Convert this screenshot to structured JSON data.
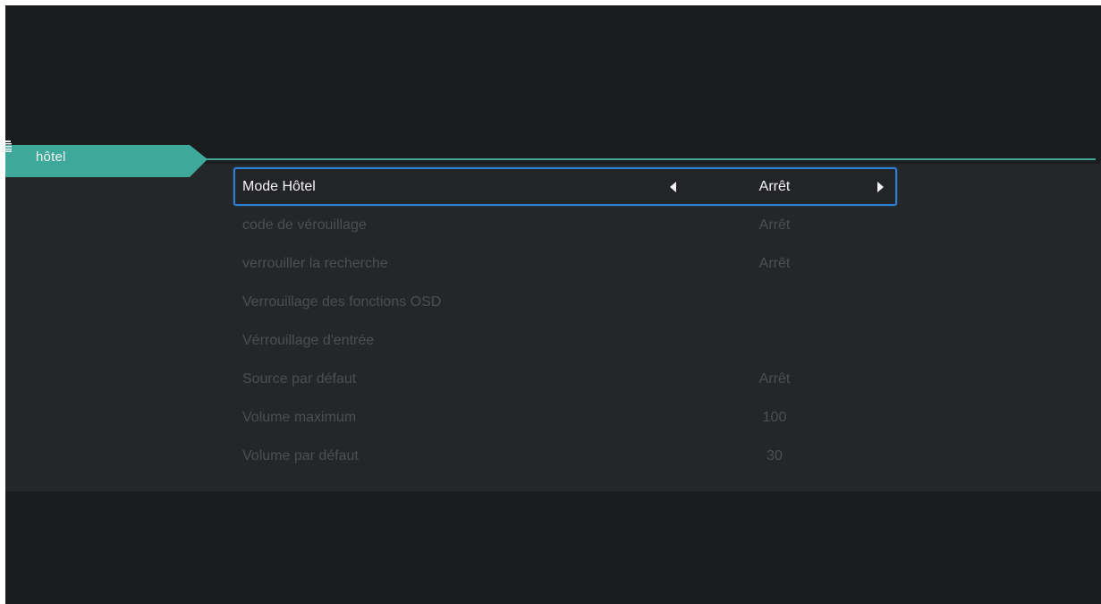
{
  "category": {
    "label": "hôtel",
    "icon": "list-icon",
    "accent_color": "#3ea89a"
  },
  "menu": {
    "items": [
      {
        "label": "Mode Hôtel",
        "value": "Arrêt"
      },
      {
        "label": "code de vérouillage",
        "value": "Arrêt"
      },
      {
        "label": "verrouiller la recherche",
        "value": "Arrêt"
      },
      {
        "label": "Verrouillage des fonctions OSD",
        "value": ""
      },
      {
        "label": "Vérrouillage d'entrée",
        "value": ""
      },
      {
        "label": "Source par défaut",
        "value": "Arrêt"
      },
      {
        "label": "Volume maximum",
        "value": "100"
      },
      {
        "label": "Volume par défaut",
        "value": "30"
      }
    ],
    "selected_index": 0,
    "selection_color": "#2f7fd4"
  }
}
